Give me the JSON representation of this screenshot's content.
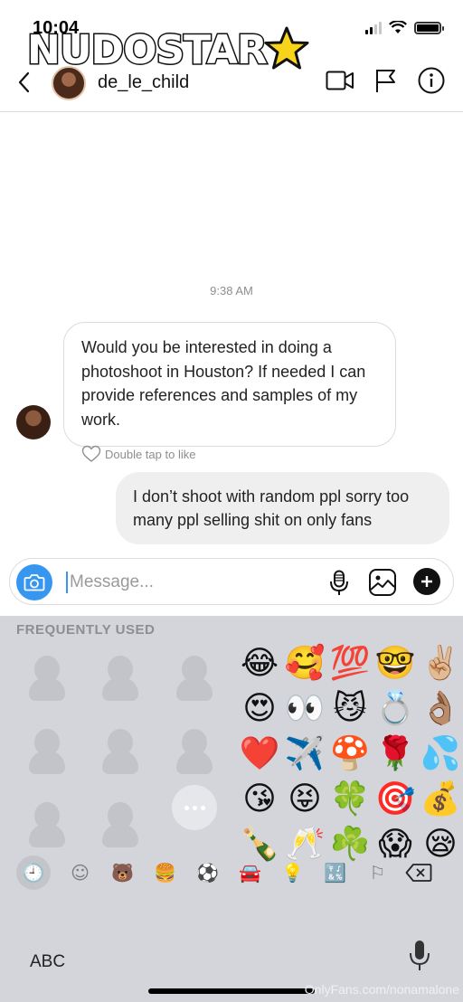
{
  "status_bar": {
    "time": "10:04"
  },
  "watermark": {
    "logo_text": "NUDOSTAR",
    "url": "OnlyFans.com/nonamalone"
  },
  "header": {
    "username": "de_le_child"
  },
  "chat": {
    "timestamp": "9:38 AM",
    "incoming_message": "Would you be interested in doing a photoshoot in Houston? If needed I can provide references and samples of my work.",
    "like_hint": "Double tap to like",
    "outgoing_message": "I don’t shoot with random ppl sorry too many ppl selling shit on only fans"
  },
  "composer": {
    "placeholder": "Message..."
  },
  "keyboard": {
    "section_title": "FREQUENTLY USED",
    "emojis": [
      "😂",
      "🥰",
      "💯",
      "🤓",
      "✌🏼",
      "😍",
      "👀",
      "😼",
      "💍",
      "👌🏽",
      "❤️",
      "✈️",
      "🍄",
      "🌹",
      "💦",
      "😘",
      "😝",
      "🍀",
      "🎯",
      "💰",
      "🍾",
      "🥂",
      "☘️",
      "😱",
      "😪"
    ],
    "categories": [
      "🕘",
      "☺",
      "🐻",
      "🍔",
      "⚽",
      "🚘",
      "💡",
      "🔣",
      "⚐"
    ],
    "abc_label": "ABC"
  }
}
